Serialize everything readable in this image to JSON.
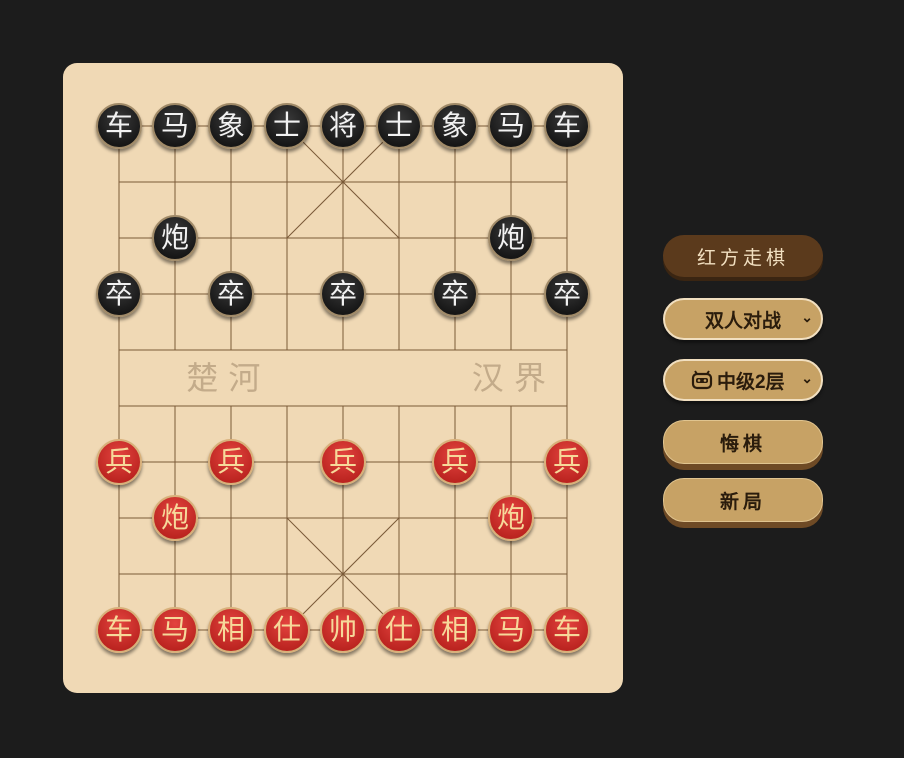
{
  "board": {
    "river_left": "楚 河",
    "river_right": "汉 界"
  },
  "pieces": [
    {
      "label": "车",
      "side": "black",
      "file": 0,
      "rank": 0
    },
    {
      "label": "马",
      "side": "black",
      "file": 1,
      "rank": 0
    },
    {
      "label": "象",
      "side": "black",
      "file": 2,
      "rank": 0
    },
    {
      "label": "士",
      "side": "black",
      "file": 3,
      "rank": 0
    },
    {
      "label": "将",
      "side": "black",
      "file": 4,
      "rank": 0
    },
    {
      "label": "士",
      "side": "black",
      "file": 5,
      "rank": 0
    },
    {
      "label": "象",
      "side": "black",
      "file": 6,
      "rank": 0
    },
    {
      "label": "马",
      "side": "black",
      "file": 7,
      "rank": 0
    },
    {
      "label": "车",
      "side": "black",
      "file": 8,
      "rank": 0
    },
    {
      "label": "炮",
      "side": "black",
      "file": 1,
      "rank": 2
    },
    {
      "label": "炮",
      "side": "black",
      "file": 7,
      "rank": 2
    },
    {
      "label": "卒",
      "side": "black",
      "file": 0,
      "rank": 3
    },
    {
      "label": "卒",
      "side": "black",
      "file": 2,
      "rank": 3
    },
    {
      "label": "卒",
      "side": "black",
      "file": 4,
      "rank": 3
    },
    {
      "label": "卒",
      "side": "black",
      "file": 6,
      "rank": 3
    },
    {
      "label": "卒",
      "side": "black",
      "file": 8,
      "rank": 3
    },
    {
      "label": "兵",
      "side": "red",
      "file": 0,
      "rank": 6
    },
    {
      "label": "兵",
      "side": "red",
      "file": 2,
      "rank": 6
    },
    {
      "label": "兵",
      "side": "red",
      "file": 4,
      "rank": 6
    },
    {
      "label": "兵",
      "side": "red",
      "file": 6,
      "rank": 6
    },
    {
      "label": "兵",
      "side": "red",
      "file": 8,
      "rank": 6
    },
    {
      "label": "炮",
      "side": "red",
      "file": 1,
      "rank": 7
    },
    {
      "label": "炮",
      "side": "red",
      "file": 7,
      "rank": 7
    },
    {
      "label": "车",
      "side": "red",
      "file": 0,
      "rank": 9
    },
    {
      "label": "马",
      "side": "red",
      "file": 1,
      "rank": 9
    },
    {
      "label": "相",
      "side": "red",
      "file": 2,
      "rank": 9
    },
    {
      "label": "仕",
      "side": "red",
      "file": 3,
      "rank": 9
    },
    {
      "label": "帅",
      "side": "red",
      "file": 4,
      "rank": 9
    },
    {
      "label": "仕",
      "side": "red",
      "file": 5,
      "rank": 9
    },
    {
      "label": "相",
      "side": "red",
      "file": 6,
      "rank": 9
    },
    {
      "label": "马",
      "side": "red",
      "file": 7,
      "rank": 9
    },
    {
      "label": "车",
      "side": "red",
      "file": 8,
      "rank": 9
    }
  ],
  "controls": {
    "turn_label": "红方走棋",
    "mode_value": "双人对战",
    "level_value": "中级2层",
    "level_icon": "robot-icon",
    "undo_label": "悔棋",
    "new_game_label": "新局"
  }
}
